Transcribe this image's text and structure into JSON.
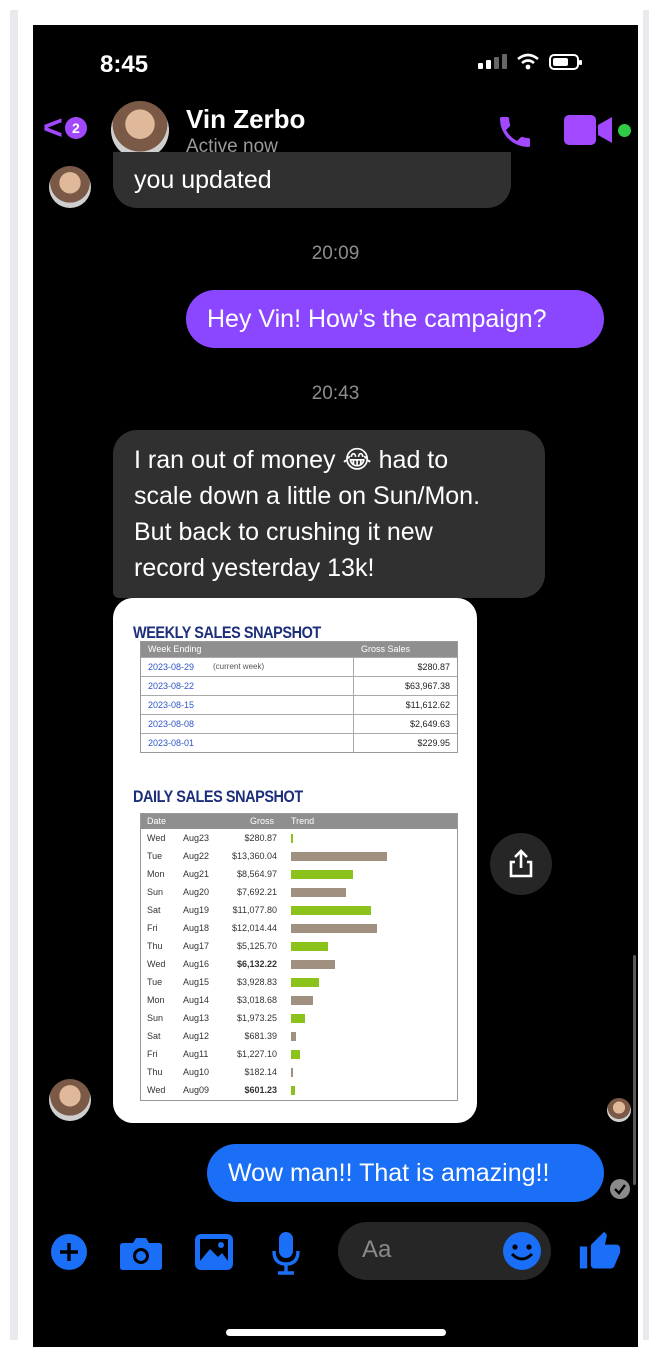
{
  "status_bar": {
    "time": "8:45"
  },
  "header": {
    "back_badge": "2",
    "contact_name": "Vin Zerbo",
    "contact_status": "Active now",
    "icons": [
      "back-chevron-icon",
      "phone-icon",
      "video-camera-icon"
    ]
  },
  "messages": {
    "prev_fragment": "you updated",
    "ts1": "20:09",
    "out1": "Hey Vin! How’s the campaign?",
    "ts2": "20:43",
    "in1_l1": "I ran out of money",
    "in1_l1b": "had to",
    "in1_l2": "scale down a little on Sun/Mon.",
    "in1_l3": "But back to crushing it new",
    "in1_l4": "record yesterday 13k!",
    "emoji": "😂",
    "out2": "Wow man!! That is amazing!!"
  },
  "weekly": {
    "title": "WEEKLY SALES SNAPSHOT",
    "col_week": "Week Ending",
    "col_gross": "Gross Sales",
    "current_note": "(current week)",
    "rows": [
      {
        "week": "2023-08-29",
        "gross": "$280.87"
      },
      {
        "week": "2023-08-22",
        "gross": "$63,967.38"
      },
      {
        "week": "2023-08-15",
        "gross": "$11,612.62"
      },
      {
        "week": "2023-08-08",
        "gross": "$2,649.63"
      },
      {
        "week": "2023-08-01",
        "gross": "$229.95"
      }
    ]
  },
  "daily": {
    "title": "DAILY SALES SNAPSHOT",
    "col_date": "Date",
    "col_gross": "Gross",
    "col_trend": "Trend",
    "rows": [
      {
        "day": "Wed",
        "date": "Aug23",
        "gross": "$280.87",
        "value": 280.87,
        "color": "#8bc21c"
      },
      {
        "day": "Tue",
        "date": "Aug22",
        "gross": "$13,360.04",
        "value": 13360.04,
        "color": "#a09080"
      },
      {
        "day": "Mon",
        "date": "Aug21",
        "gross": "$8,564.97",
        "value": 8564.97,
        "color": "#8bc21c"
      },
      {
        "day": "Sun",
        "date": "Aug20",
        "gross": "$7,692.21",
        "value": 7692.21,
        "color": "#a09080"
      },
      {
        "day": "Sat",
        "date": "Aug19",
        "gross": "$11,077.80",
        "value": 11077.8,
        "color": "#8bc21c"
      },
      {
        "day": "Fri",
        "date": "Aug18",
        "gross": "$12,014.44",
        "value": 12014.44,
        "color": "#a09080"
      },
      {
        "day": "Thu",
        "date": "Aug17",
        "gross": "$5,125.70",
        "value": 5125.7,
        "color": "#8bc21c"
      },
      {
        "day": "Wed",
        "date": "Aug16",
        "gross": "$6,132.22",
        "value": 6132.22,
        "color": "#a09080"
      },
      {
        "day": "Tue",
        "date": "Aug15",
        "gross": "$3,928.83",
        "value": 3928.83,
        "color": "#8bc21c"
      },
      {
        "day": "Mon",
        "date": "Aug14",
        "gross": "$3,018.68",
        "value": 3018.68,
        "color": "#a09080"
      },
      {
        "day": "Sun",
        "date": "Aug13",
        "gross": "$1,973.25",
        "value": 1973.25,
        "color": "#8bc21c"
      },
      {
        "day": "Sat",
        "date": "Aug12",
        "gross": "$681.39",
        "value": 681.39,
        "color": "#a09080"
      },
      {
        "day": "Fri",
        "date": "Aug11",
        "gross": "$1,227.10",
        "value": 1227.1,
        "color": "#8bc21c"
      },
      {
        "day": "Thu",
        "date": "Aug10",
        "gross": "$182.14",
        "value": 182.14,
        "color": "#a09080"
      },
      {
        "day": "Wed",
        "date": "Aug09",
        "gross": "$601.23",
        "value": 601.23,
        "color": "#8bc21c"
      }
    ]
  },
  "composer": {
    "placeholder": "Aa",
    "icons": [
      "plus-icon",
      "camera-icon",
      "gallery-icon",
      "microphone-icon",
      "emoji-icon",
      "thumbs-up-icon"
    ]
  },
  "colors": {
    "accent": "#a249ff",
    "outgoing": "#8b47ff",
    "blue": "#1a6ff6",
    "incoming": "#303030"
  }
}
